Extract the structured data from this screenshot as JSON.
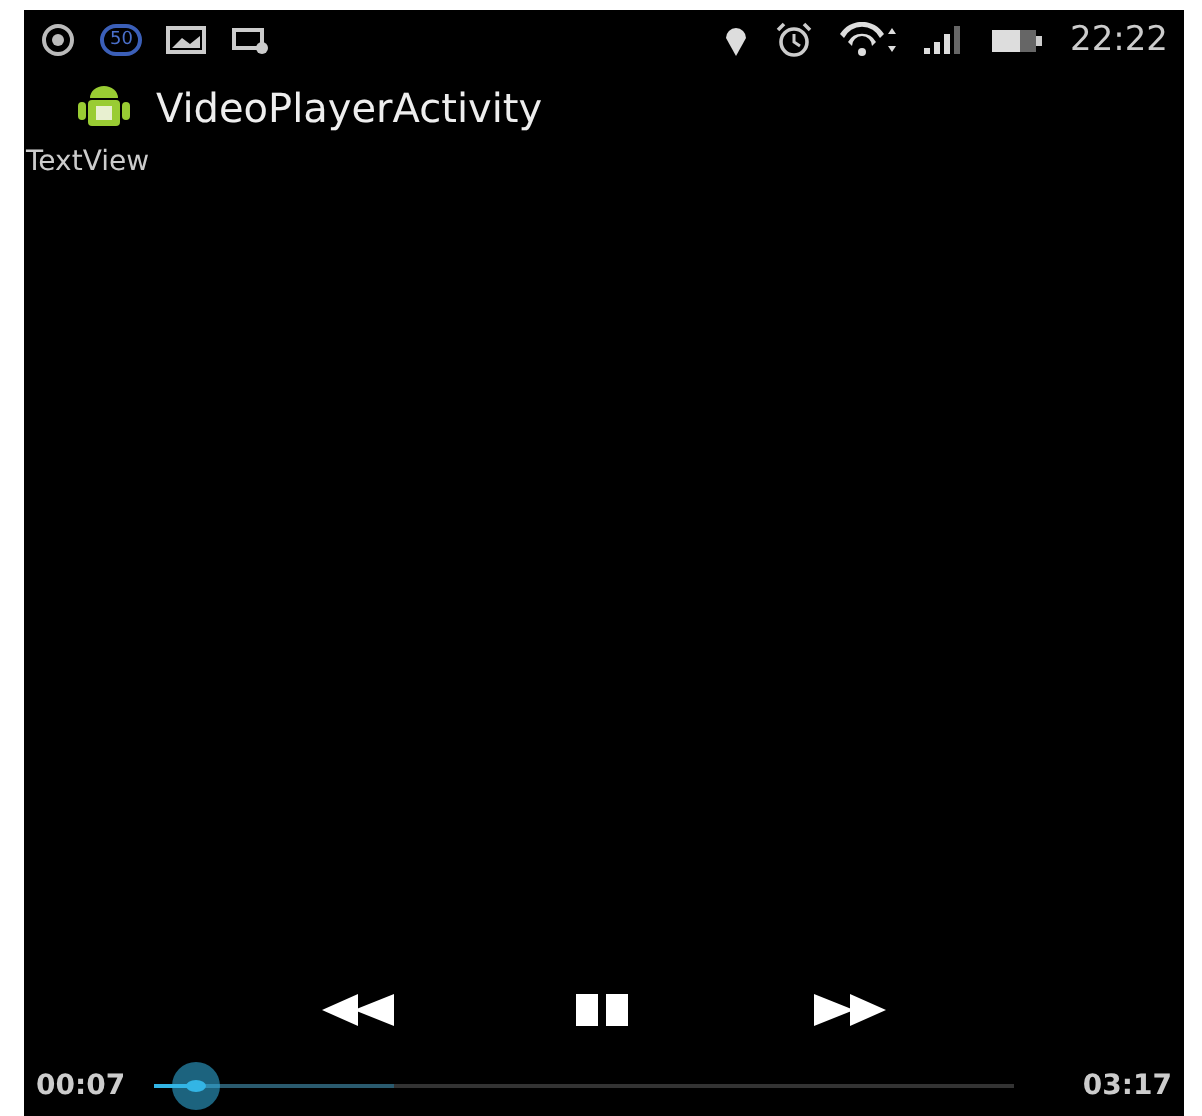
{
  "status_bar": {
    "time": "22:22",
    "badge": "50"
  },
  "action_bar": {
    "title": "VideoPlayerActivity"
  },
  "text_view": {
    "text": "TextView"
  },
  "media_controller": {
    "playing": true,
    "elapsed": "00:07",
    "duration": "03:17",
    "seek": {
      "level": 0.05
    },
    "buffer": {
      "level": 0.28
    }
  }
}
